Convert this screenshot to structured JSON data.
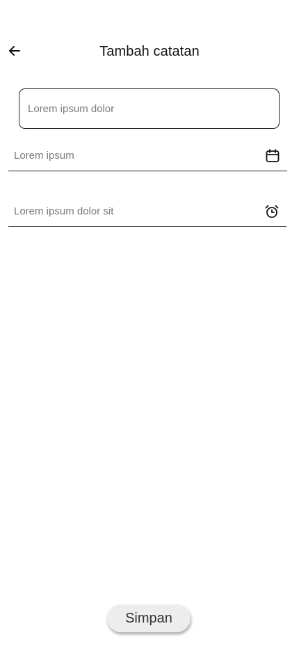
{
  "header": {
    "back_icon": "arrow-left-icon",
    "title": "Tambah catatan"
  },
  "form": {
    "title_field": {
      "placeholder": "Lorem ipsum dolor",
      "value": ""
    },
    "date_field": {
      "placeholder": "Lorem ipsum",
      "value": "",
      "icon": "calendar-icon"
    },
    "time_field": {
      "placeholder": "Lorem ipsum dolor sit",
      "value": "",
      "icon": "alarm-clock-icon"
    }
  },
  "actions": {
    "save_label": "Simpan"
  },
  "colors": {
    "background": "#ffffff",
    "text": "#111111",
    "border": "#222222",
    "placeholder": "#7a7a7a",
    "button_bg": "#ededed"
  }
}
